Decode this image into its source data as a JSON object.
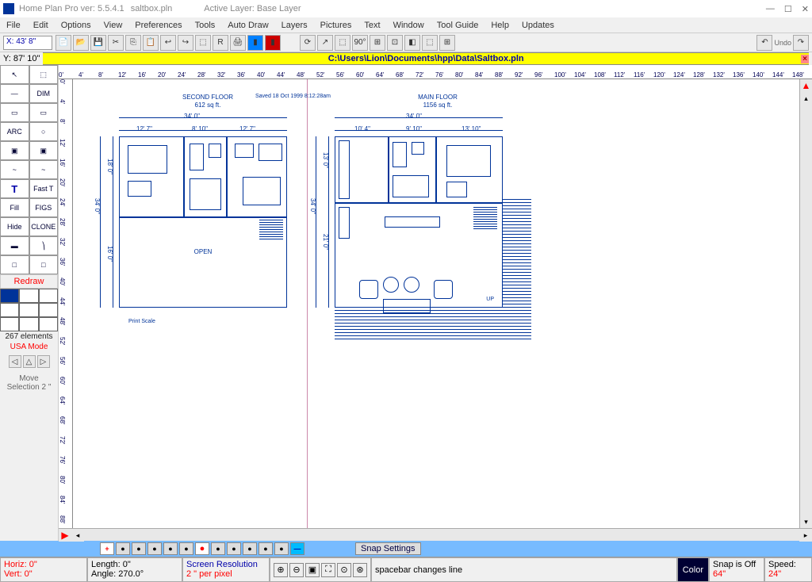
{
  "title": {
    "app": "Home Plan Pro ver: 5.5.4.1",
    "file": "saltbox.pln",
    "layer": "Active Layer: Base Layer"
  },
  "menu": [
    "File",
    "Edit",
    "Options",
    "View",
    "Preferences",
    "Tools",
    "Auto Draw",
    "Layers",
    "Pictures",
    "Text",
    "Window",
    "Tool Guide",
    "Help",
    "Updates"
  ],
  "coords": {
    "x": "X: 43' 8\"",
    "y": "Y: 87' 10\""
  },
  "filepath": "C:\\Users\\Lion\\Documents\\hpp\\Data\\Saltbox.pln",
  "hruler": [
    "0'",
    "4'",
    "8'",
    "12'",
    "16'",
    "20'",
    "24'",
    "28'",
    "32'",
    "36'",
    "40'",
    "44'",
    "48'",
    "52'",
    "56'",
    "60'",
    "64'",
    "68'",
    "72'",
    "76'",
    "80'",
    "84'",
    "88'",
    "92'",
    "96'",
    "100'",
    "104'",
    "108'",
    "112'",
    "116'",
    "120'",
    "124'",
    "128'",
    "132'",
    "136'",
    "140'",
    "144'",
    "148'"
  ],
  "vruler": [
    "0'",
    "4'",
    "8'",
    "12'",
    "16'",
    "20'",
    "24'",
    "28'",
    "32'",
    "36'",
    "40'",
    "44'",
    "48'",
    "52'",
    "56'",
    "60'",
    "64'",
    "68'",
    "72'",
    "76'",
    "80'",
    "84'",
    "88'"
  ],
  "tools": [
    {
      "n": "arrow",
      "t": "↖"
    },
    {
      "n": "select",
      "t": "⬚"
    },
    {
      "n": "line",
      "t": "—"
    },
    {
      "n": "dim",
      "t": "DIM"
    },
    {
      "n": "rect",
      "t": "▭"
    },
    {
      "n": "rect2",
      "t": "▭"
    },
    {
      "n": "arc",
      "t": "ARC"
    },
    {
      "n": "circle",
      "t": "○"
    },
    {
      "n": "wall",
      "t": "▣"
    },
    {
      "n": "wall2",
      "t": "▣"
    },
    {
      "n": "curve",
      "t": "~"
    },
    {
      "n": "curve2",
      "t": "~"
    },
    {
      "n": "text",
      "t": "T"
    },
    {
      "n": "fast",
      "t": "Fast T"
    },
    {
      "n": "fill",
      "t": "Fill"
    },
    {
      "n": "figs",
      "t": "FIGS"
    },
    {
      "n": "hide",
      "t": "Hide"
    },
    {
      "n": "clone",
      "t": "CLONE"
    },
    {
      "n": "t1",
      "t": "▬"
    },
    {
      "n": "t2",
      "t": "⎞"
    },
    {
      "n": "t3",
      "t": "□"
    },
    {
      "n": "t4",
      "t": "□"
    }
  ],
  "redraw": "Redraw",
  "elements": "267 elements",
  "mode": "USA Mode",
  "move_selection": "Move Selection 2 \"",
  "floors": {
    "second": {
      "title": "SECOND FLOOR",
      "area": "612 sq ft.",
      "save": "Saved 18 Oct 1999  8:12:28am",
      "dims": {
        "top_total": "34' 0\"",
        "left_total": "34' 0\"",
        "left_upper": "18' 0\"",
        "left_lower": "16' 0\"",
        "top1": "12' 7\"",
        "top2": "8' 10\"",
        "top3": "12' 7\""
      },
      "open": "OPEN",
      "print": "Print Scale"
    },
    "main": {
      "title": "MAIN FLOOR",
      "area": "1156 sq ft.",
      "dims": {
        "top_total": "34' 0\"",
        "left_total": "34' 0\"",
        "left_upper": "13' 0\"",
        "left_lower": "21' 0\"",
        "top1": "10' 4\"",
        "top2": "9' 10\"",
        "top3": "13' 10\""
      },
      "up": "UP"
    }
  },
  "snap": {
    "settings": "Snap Settings"
  },
  "status": {
    "horiz": "Horiz: 0\"",
    "vert": "Vert:  0\"",
    "length": "Length:  0\"",
    "angle": "Angle: 270.0°",
    "res1": "Screen Resolution",
    "res2": "2 \" per pixel",
    "hint": "spacebar changes line",
    "color": "Color",
    "snap1": "Snap is Off",
    "snap2": "64\"",
    "speed1": "Speed:",
    "speed2": "24\""
  },
  "undo_label": "Undo"
}
